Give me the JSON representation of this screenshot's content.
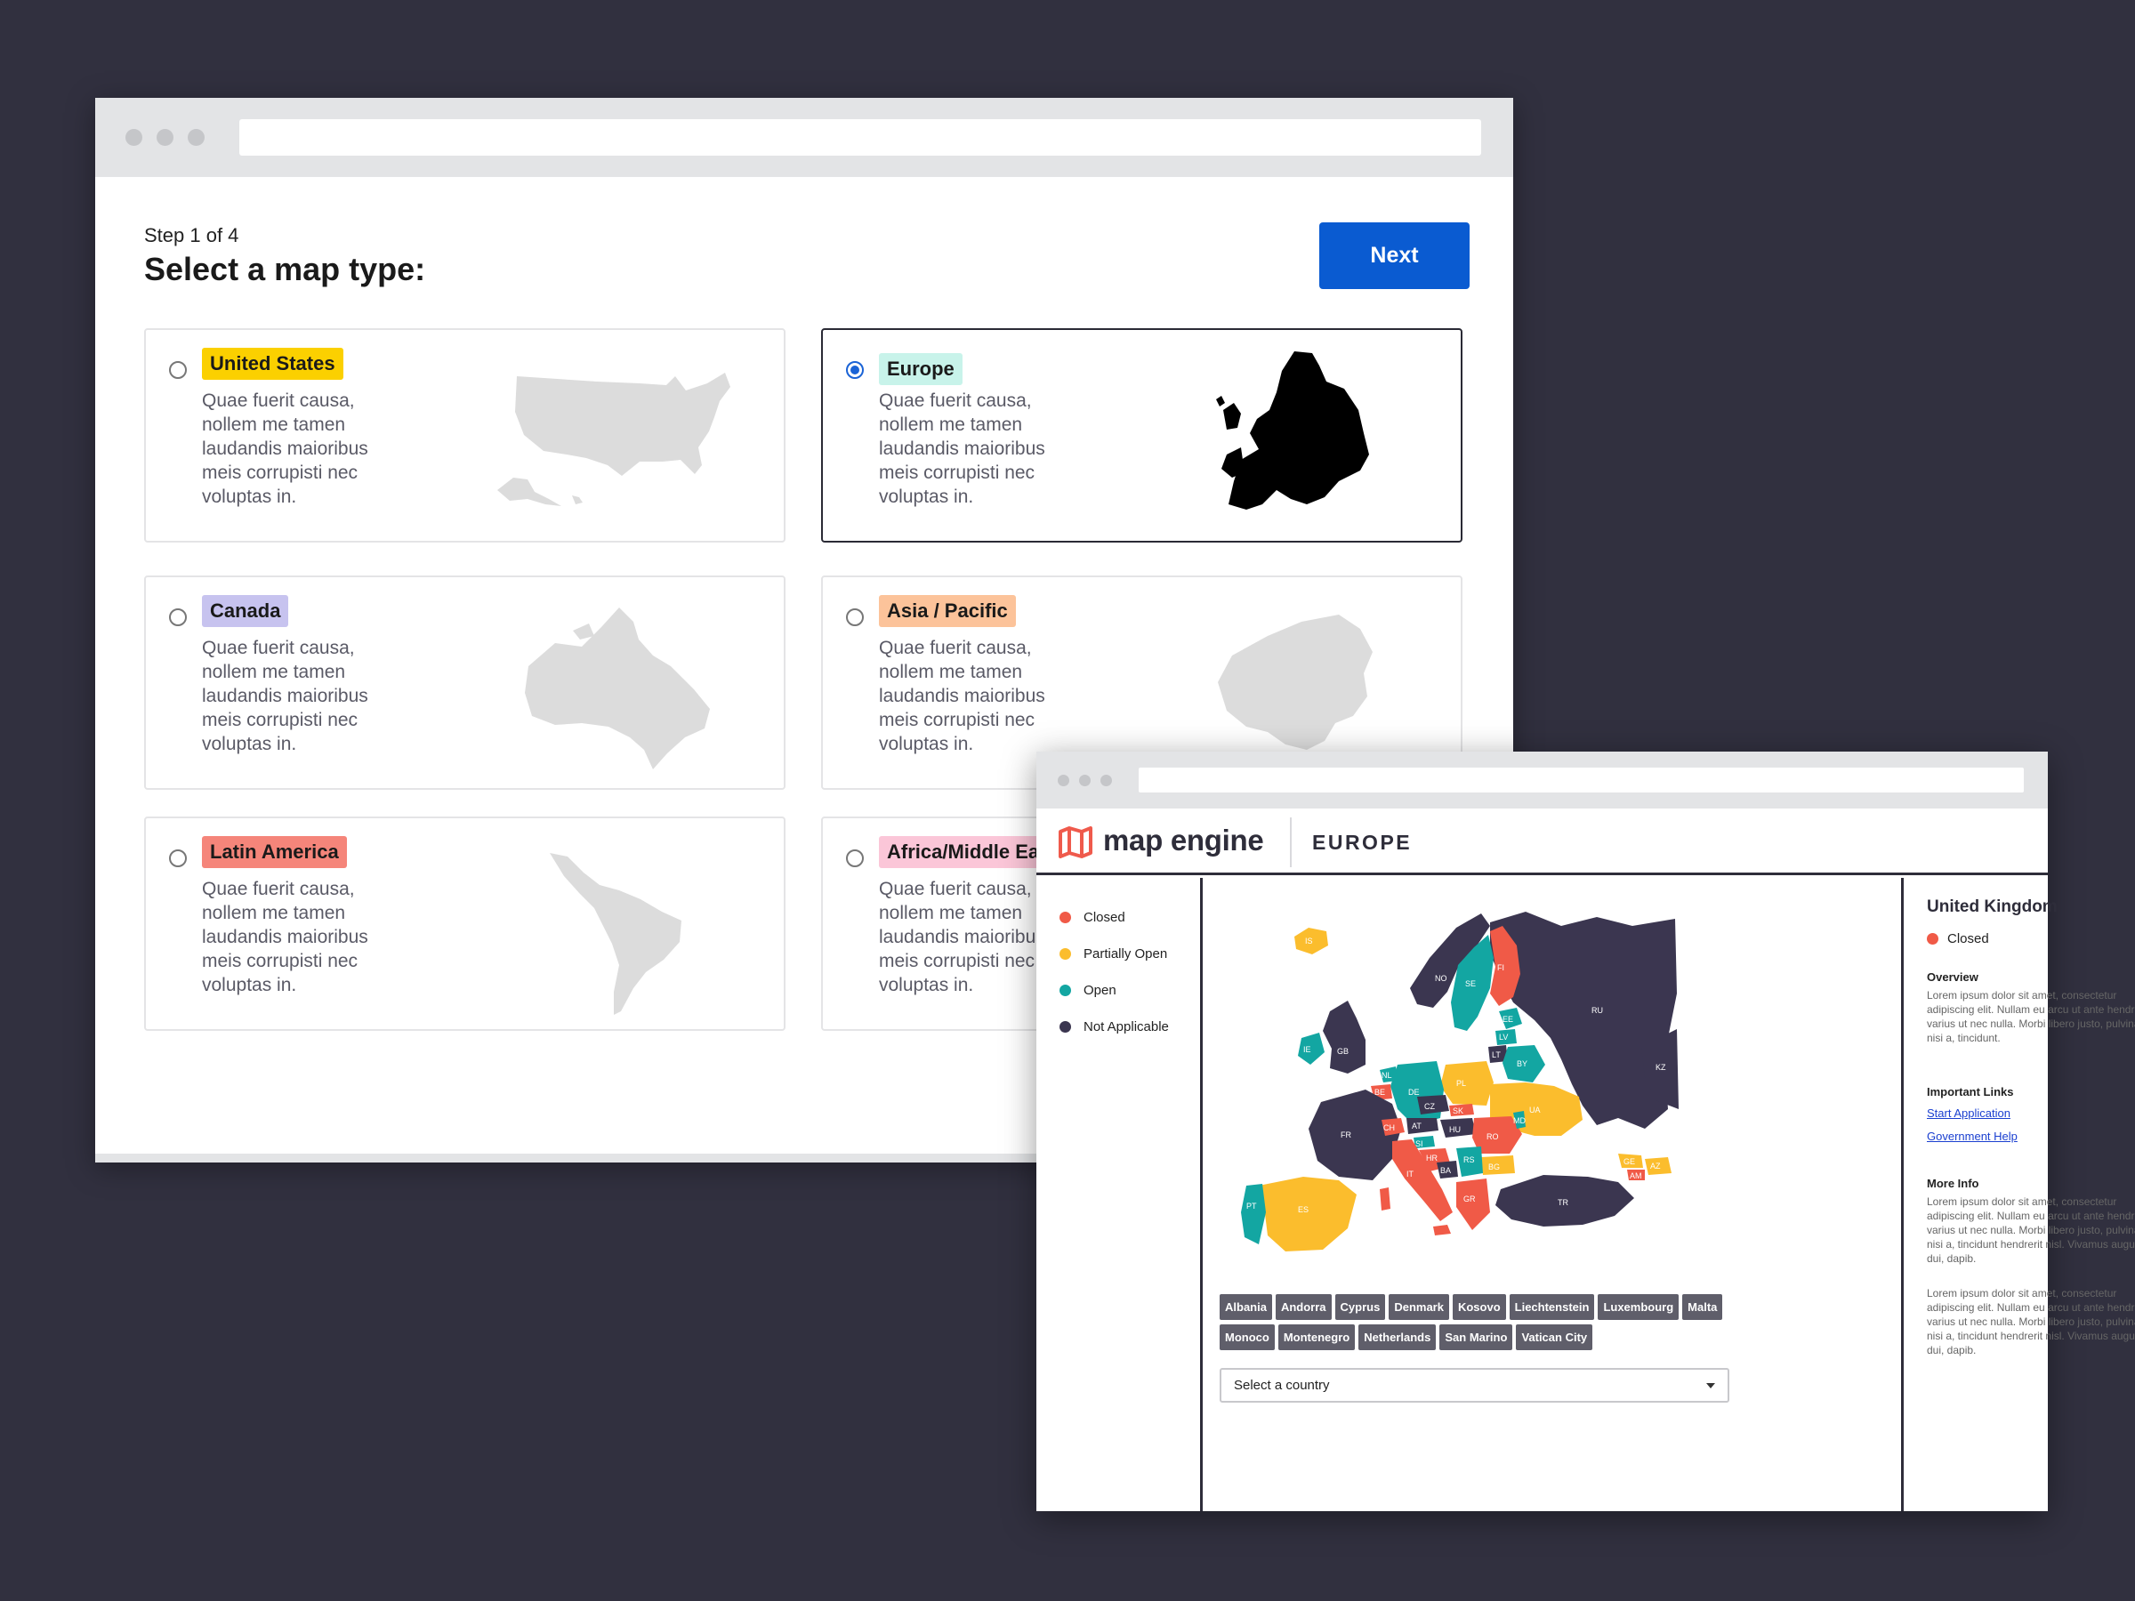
{
  "wizard": {
    "step_label": "Step 1 of 4",
    "title": "Select a map type:",
    "next_label": "Next",
    "description": "Quae fuerit causa, nollem me tamen laudandis maioribus meis corrupisti nec voluptas in.",
    "options": [
      {
        "label": "United States",
        "tag_color": "#fbd000",
        "selected": false
      },
      {
        "label": "Europe",
        "tag_color": "#c8f3ea",
        "selected": true
      },
      {
        "label": "Canada",
        "tag_color": "#c7c3ef",
        "selected": false
      },
      {
        "label": "Asia / Pacific",
        "tag_color": "#fcc39a",
        "selected": false
      },
      {
        "label": "Latin America",
        "tag_color": "#f5857a",
        "selected": false
      },
      {
        "label": "Africa/Middle East",
        "tag_color": "#fbc6d8",
        "selected": false
      }
    ]
  },
  "engine": {
    "brand": "map engine",
    "region": "EUROPE",
    "legend": [
      {
        "label": "Closed",
        "color": "#f05a47"
      },
      {
        "label": "Partially Open",
        "color": "#fbbd2d"
      },
      {
        "label": "Open",
        "color": "#13a6a2"
      },
      {
        "label": "Not Applicable",
        "color": "#3b3650"
      }
    ],
    "chips": [
      "Albania",
      "Andorra",
      "Cyprus",
      "Denmark",
      "Kosovo",
      "Liechtenstein",
      "Luxembourg",
      "Malta",
      "Monoco",
      "Montenegro",
      "Netherlands",
      "San Marino",
      "Vatican City"
    ],
    "select_placeholder": "Select a country",
    "map_labels": [
      "IS",
      "NO",
      "SE",
      "FI",
      "EE",
      "LV",
      "LT",
      "BY",
      "RU",
      "KZ",
      "IE",
      "GB",
      "NL",
      "BE",
      "DE",
      "PL",
      "UA",
      "FR",
      "CH",
      "AT",
      "CZ",
      "SK",
      "HU",
      "RO",
      "MD",
      "SI",
      "HR",
      "BA",
      "RS",
      "BG",
      "IT",
      "PT",
      "ES",
      "GR",
      "TR",
      "GE",
      "AZ",
      "AM"
    ],
    "panel": {
      "country": "United Kingdom",
      "status": "Closed",
      "status_color": "#f05a47",
      "overview_heading": "Overview",
      "overview_text": "Lorem ipsum dolor sit amet, consectetur adipiscing elit. Nullam eu arcu ut ante hendrerit varius ut nec nulla. Morbi libero justo, pulvinar at nisi a, tincidunt.",
      "links_heading": "Important Links",
      "link1": "Start Application",
      "link2": "Government Help",
      "more_heading": "More Info",
      "more_text1": "Lorem ipsum dolor sit amet, consectetur adipiscing elit. Nullam eu arcu ut ante hendrerit varius ut nec nulla. Morbi libero justo, pulvinar at nisi a, tincidunt hendrerit nisl. Vivamus augue dui, dapib.",
      "more_text2": "Lorem ipsum dolor sit amet, consectetur adipiscing elit. Nullam eu arcu ut ante hendrerit varius ut nec nulla. Morbi libero justo, pulvinar at nisi a, tincidunt hendrerit nisl. Vivamus augue dui, dapib."
    }
  }
}
